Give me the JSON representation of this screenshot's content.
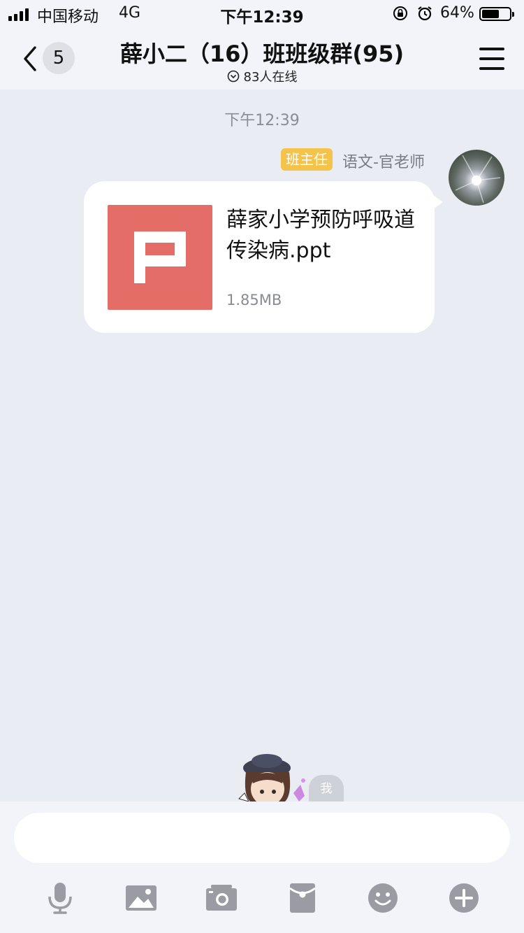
{
  "status_bar": {
    "carrier": "中国移动",
    "network": "4G",
    "time": "下午12:39",
    "battery_pct": "64%",
    "battery_level": 0.64
  },
  "nav": {
    "back_badge": "5",
    "title": "薛小二（16）班班级群(95)",
    "online": "83人在线"
  },
  "chat": {
    "timestamp": "下午12:39",
    "message": {
      "role_tag": "班主任",
      "sender": "语文-官老师",
      "file_icon": "ppt-file-icon",
      "file_name": "薛家小学预防呼吸道传染病.ppt",
      "file_size": "1.85MB"
    }
  },
  "mascot": {
    "label": "我"
  },
  "input": {
    "placeholder": ""
  },
  "toolbar": {
    "icons": [
      "microphone-icon",
      "image-icon",
      "camera-icon",
      "red-packet-icon",
      "emoji-icon",
      "plus-icon"
    ],
    "icon_color": "#9a9ba3"
  },
  "colors": {
    "background": "#eaecf3",
    "bar": "#f3f4f9",
    "role_tag": "#f4c34a",
    "ppt_icon": "#e46d68"
  }
}
